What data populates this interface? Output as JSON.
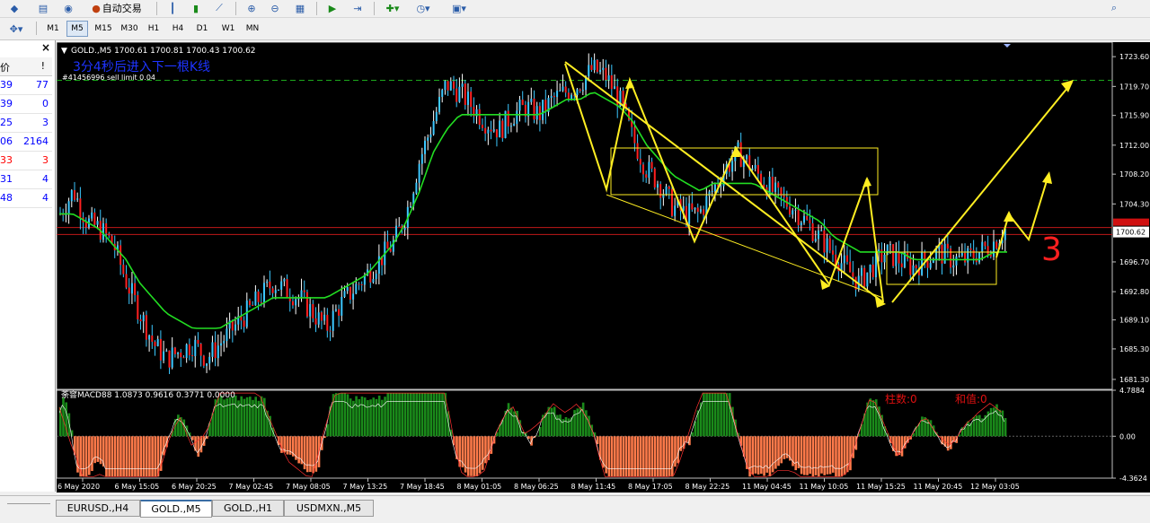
{
  "toolbar": {
    "autotrade_label": "自动交易",
    "timeframes": [
      "M1",
      "M5",
      "M15",
      "M30",
      "H1",
      "H4",
      "D1",
      "W1",
      "MN"
    ],
    "active_timeframe": "M5"
  },
  "left_panel": {
    "close_label": "×",
    "header": [
      "价",
      "!"
    ],
    "rows": [
      {
        "a": "39",
        "b": "77",
        "color": "#0000ff"
      },
      {
        "a": "39",
        "b": "0",
        "color": "#0000ff"
      },
      {
        "a": "25",
        "b": "3",
        "color": "#0000ff"
      },
      {
        "a": "06",
        "b": "2164",
        "color": "#0000ff"
      },
      {
        "a": "33",
        "b": "3",
        "color": "#ff0000"
      },
      {
        "a": "31",
        "b": "4",
        "color": "#0000ff"
      },
      {
        "a": "48",
        "b": "4",
        "color": "#0000ff"
      }
    ]
  },
  "chart": {
    "symbol_info": "GOLD.,M5  1700.61 1700.81 1700.43 1700.62",
    "annotation": "3分4秒后进入下一根K线",
    "order_label": "#41456996 sell limit 0.04",
    "current_price": "1700.62",
    "macd_label": "荼窨MACD88 1.0873 0.9616 0.3771 0.0000",
    "macd_right_1": "柱数:0",
    "macd_right_2": "和值:0",
    "handwritten": "3"
  },
  "chart_data": {
    "type": "candlestick",
    "instrument": "GOLD.,M5",
    "price_axis": [
      1723.6,
      1719.7,
      1715.9,
      1712.0,
      1708.2,
      1704.3,
      1700.62,
      1696.7,
      1692.8,
      1689.1,
      1685.3,
      1681.3
    ],
    "macd_axis": [
      "4.7884",
      "0.00",
      "-4.3624"
    ],
    "time_axis": [
      "6 May 2020",
      "6 May 15:05",
      "6 May 20:25",
      "7 May 02:45",
      "7 May 08:05",
      "7 May 13:25",
      "7 May 18:45",
      "8 May 01:05",
      "8 May 06:25",
      "8 May 11:45",
      "8 May 17:05",
      "8 May 22:25",
      "11 May 04:45",
      "11 May 10:05",
      "11 May 15:25",
      "11 May 20:45",
      "12 May 03:05"
    ],
    "close_path": [
      1703,
      1706,
      1702,
      1701,
      1699,
      1694,
      1690,
      1686,
      1684,
      1685,
      1686,
      1684,
      1686,
      1688,
      1690,
      1692,
      1694,
      1693,
      1692,
      1690,
      1688,
      1691,
      1693,
      1695,
      1697,
      1699,
      1703,
      1710,
      1715,
      1720,
      1719,
      1717,
      1715,
      1714,
      1716,
      1717,
      1716,
      1718,
      1719,
      1720,
      1722,
      1721,
      1718,
      1713,
      1709,
      1707,
      1704,
      1703,
      1703,
      1706,
      1709,
      1711,
      1709,
      1707,
      1705,
      1704,
      1702,
      1700,
      1698,
      1696,
      1694,
      1696,
      1698,
      1697,
      1696,
      1697,
      1698,
      1697,
      1697,
      1698,
      1699,
      1701
    ],
    "ma_path": [
      1703,
      1703,
      1702,
      1701,
      1699,
      1697,
      1694,
      1692,
      1690,
      1689,
      1688,
      1688,
      1688,
      1689,
      1690,
      1691,
      1692,
      1692,
      1692,
      1692,
      1692,
      1693,
      1694,
      1695,
      1697,
      1699,
      1702,
      1706,
      1711,
      1714,
      1716,
      1716,
      1716,
      1716,
      1716,
      1716,
      1716,
      1717,
      1718,
      1718,
      1719,
      1718,
      1717,
      1715,
      1712,
      1710,
      1708,
      1707,
      1706,
      1707,
      1707,
      1707,
      1707,
      1706,
      1705,
      1704,
      1703,
      1702,
      1700,
      1699,
      1698,
      1698,
      1698,
      1698,
      1697,
      1697,
      1697,
      1697,
      1697,
      1697,
      1698,
      1698
    ],
    "reference_lines": {
      "dashed_green": 1720.5,
      "red_lines": [
        1701.2,
        1700.3
      ]
    }
  },
  "tabs": [
    "EURUSD.,H4",
    "GOLD.,M5",
    "GOLD.,H1",
    "USDMXN.,M5"
  ],
  "active_tab": "GOLD.,M5"
}
